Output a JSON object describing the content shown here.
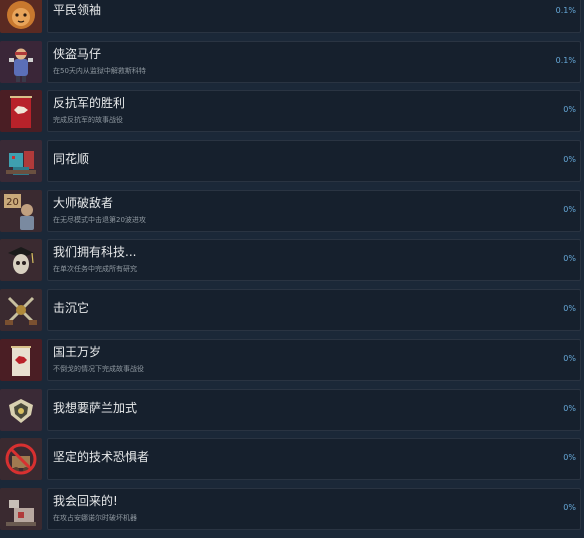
{
  "achievements": [
    {
      "title": "平民领袖",
      "desc": "",
      "percent": "0.1%",
      "icon": "lion-mask-icon"
    },
    {
      "title": "侠盗马仔",
      "desc": "在50天内从监狱中解救斯科特",
      "percent": "0.1%",
      "icon": "bandit-icon"
    },
    {
      "title": "反抗军的胜利",
      "desc": "完成反抗军的故事战役",
      "percent": "0%",
      "icon": "rebel-banner-icon"
    },
    {
      "title": "同花顺",
      "desc": "",
      "percent": "0%",
      "icon": "robot-knight-icon"
    },
    {
      "title": "大师破敌者",
      "desc": "在无尽模式中击退第20波进攻",
      "percent": "0%",
      "icon": "wave-twenty-icon"
    },
    {
      "title": "我们拥有科技...",
      "desc": "在单次任务中完成所有研究",
      "percent": "0%",
      "icon": "scholar-skull-icon"
    },
    {
      "title": "击沉它",
      "desc": "",
      "percent": "0%",
      "icon": "crossed-swords-icon"
    },
    {
      "title": "国王万岁",
      "desc": "不倒戈的情况下完成故事战役",
      "percent": "0%",
      "icon": "king-banner-icon"
    },
    {
      "title": "我想要萨兰加式",
      "desc": "",
      "percent": "0%",
      "icon": "winged-crest-icon"
    },
    {
      "title": "坚定的技术恐惧者",
      "desc": "",
      "percent": "0%",
      "icon": "no-machines-icon"
    },
    {
      "title": "我会回来的!",
      "desc": "在攻占安娜诺尔时破坏机器",
      "percent": "0%",
      "icon": "broken-machine-icon"
    }
  ],
  "colors": {
    "background": "#1b2838",
    "panel": "#16202d",
    "title": "#e7e9ea",
    "desc": "#8f98a0",
    "percent": "#66a8d8"
  }
}
